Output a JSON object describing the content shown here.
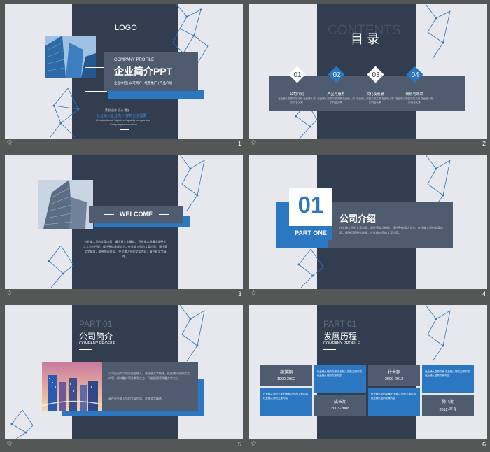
{
  "slides": [
    {
      "number": "1",
      "logo": "LOGO",
      "profile": "COMPANY PROFILE",
      "title": "企业简介PPT",
      "menu": "企业介绍 | 公司简介 | 经营推广 | 产品介绍",
      "names": "策划  创作  设计  署名",
      "blue_line": "此处输入企业简介 好的企业需要",
      "intro1": "Introduction of high-level quality companies",
      "intro2": "Company introduction"
    },
    {
      "number": "2",
      "ghost": "CONTENTS",
      "title": "目 录",
      "items": [
        {
          "num": "01",
          "label": "公司介绍",
          "desc": "在此输入您的内容文案 在此输入您的内容文案"
        },
        {
          "num": "02",
          "label": "产品与服务",
          "desc": "在此输入您的内容文案 在此输入您的内容文案"
        },
        {
          "num": "03",
          "label": "文化及愿景",
          "desc": "在此输入您的内容文案 在此输入您的内容文案"
        },
        {
          "num": "04",
          "label": "规划与未来",
          "desc": "在此输入您的内容文案 在此输入您的内容文案"
        }
      ]
    },
    {
      "number": "3",
      "welcome": "WELCOME",
      "para": "在此输入您的文案内容，请注意文字精炼。 可根据实际情况调整文字大小与行距，保持整体美观大方。在此输入您的文案内容，请注意文字精炼，保持版面简洁。 在此输入您的文案内容，请注意文字精炼。"
    },
    {
      "number": "4",
      "part_num": "01",
      "part_label": "PART ONE",
      "title": "公司介绍",
      "desc": "在此输入您的文案内容，请注意文字精炼，保持整体简洁大方。在此输入您的文案内容，保持页面整洁美观，在此输入您的文案内容。"
    },
    {
      "number": "5",
      "part": "PART 01",
      "title": "公司简介",
      "profile": "COMPANY PROFILE",
      "para1": "公司企业简介内容在此输入，请注意文字精炼。在此输入您的文案内容，保持整体简洁美观大方，可根据需要调整文字大小。",
      "para2": "请在此处输入您的文案内容，注意文字精炼。"
    },
    {
      "number": "6",
      "part": "PART 01",
      "title": "发展历程",
      "profile": "COMPANY PROFILE",
      "stages": [
        {
          "name": "萌芽期",
          "years": "1990-2002",
          "desc": "在此输入您的文案 在此输入您的文案内容 在此输入您的文案内容"
        },
        {
          "name": "成长期",
          "years": "2003-2008",
          "desc": "在此输入您的文案 在此输入您的文案内容 在此输入您的文案内容"
        },
        {
          "name": "壮大期",
          "years": "2009-2012",
          "desc": "在此输入您的文案 在此输入您的文案内容 在此输入您的文案内容"
        },
        {
          "name": "腾飞期",
          "years": "2012-至今",
          "desc": "在此输入您的文案 在此输入您的文案内容 在此输入您的文案内容"
        }
      ]
    }
  ],
  "footer_icon": "star-icon"
}
